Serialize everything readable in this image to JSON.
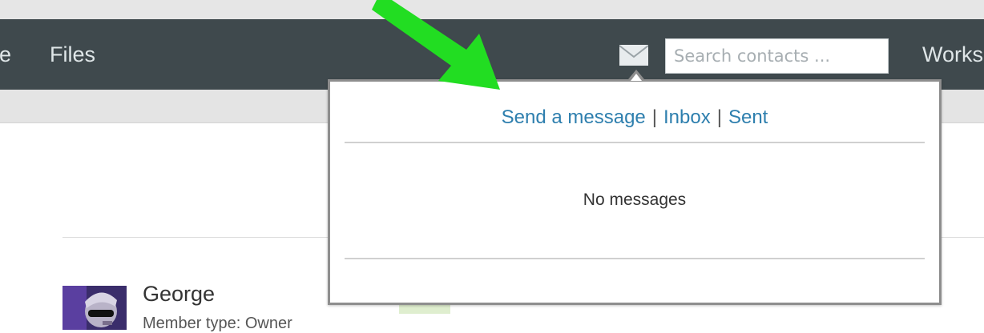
{
  "nav": {
    "home_partial": "ne",
    "files": "Files",
    "workspace_partial": "Works"
  },
  "mail_icon": "envelope-icon",
  "search": {
    "placeholder": "Search contacts ...",
    "value": ""
  },
  "messages_dropdown": {
    "send_link": "Send a message",
    "inbox_link": "Inbox",
    "sent_link": "Sent",
    "separator": "|",
    "empty_text": "No messages"
  },
  "member": {
    "name": "George",
    "type_text": "Member type: Owner"
  },
  "colors": {
    "navbar": "#3f494d",
    "link": "#2e7fae",
    "annotation_arrow": "#22dd22"
  }
}
